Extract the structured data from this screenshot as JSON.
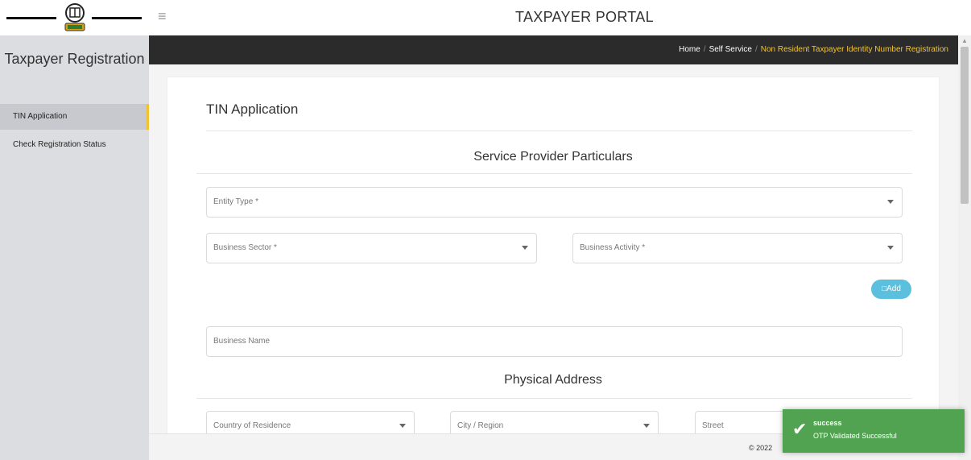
{
  "header": {
    "portal_title": "TAXPAYER PORTAL",
    "menu_icon": "hamburger-icon",
    "logo_icon": "emblem-icon"
  },
  "sidebar": {
    "title": "Taxpayer Registration",
    "items": [
      {
        "label": "TIN Application",
        "active": true
      },
      {
        "label": "Check Registration Status",
        "active": false
      }
    ]
  },
  "breadcrumb": {
    "home": "Home",
    "self_service": "Self Service",
    "current": "Non Resident Taxpayer Identity Number Registration"
  },
  "form": {
    "title": "TIN Application",
    "section_service_provider": "Service Provider Particulars",
    "entity_type_placeholder": "Entity Type *",
    "business_sector_placeholder": "Business Sector *",
    "business_activity_placeholder": "Business Activity *",
    "add_label": "□Add",
    "business_name_placeholder": "Business Name",
    "section_physical_address": "Physical Address",
    "country_placeholder": "Country of Residence",
    "city_placeholder": "City / Region",
    "street_placeholder": "Street"
  },
  "footer": {
    "copyright": "© 2022"
  },
  "toast": {
    "title": "success",
    "message": "OTP Validated Successful",
    "color": "#51a351"
  },
  "colors": {
    "accent": "#f1c232",
    "breadcrumb_current": "#f4c430",
    "add_button": "#5bc0de"
  }
}
